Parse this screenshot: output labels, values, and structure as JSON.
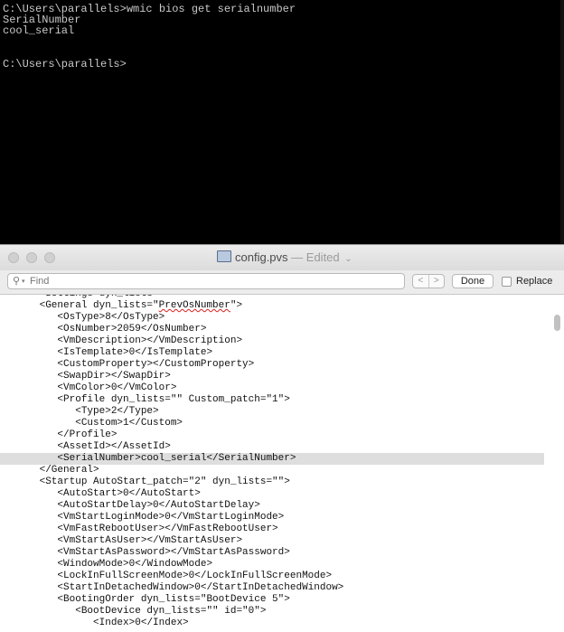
{
  "console": {
    "lines": [
      "C:\\Users\\parallels>wmic bios get serialnumber",
      "SerialNumber",
      "cool_serial",
      "",
      "",
      "C:\\Users\\parallels>"
    ]
  },
  "window": {
    "title": "config.pvs",
    "edited_label": "— Edited",
    "title_chevron": "⌄"
  },
  "findbar": {
    "search_placeholder": "Find",
    "prev_label": "<",
    "next_label": ">",
    "done_label": "Done",
    "replace_label": "Replace"
  },
  "editor": {
    "lines": [
      {
        "indent": 6,
        "text": "<Settings dyn_lists=\"\">"
      },
      {
        "indent": 6,
        "pre": "<General dyn_lists=\"",
        "spell": "PrevOsNumber",
        "post": "\">"
      },
      {
        "indent": 9,
        "text": "<OsType>8</OsType>"
      },
      {
        "indent": 9,
        "text": "<OsNumber>2059</OsNumber>"
      },
      {
        "indent": 9,
        "text": "<VmDescription></VmDescription>"
      },
      {
        "indent": 9,
        "text": "<IsTemplate>0</IsTemplate>"
      },
      {
        "indent": 9,
        "text": "<CustomProperty></CustomProperty>"
      },
      {
        "indent": 9,
        "text": "<SwapDir></SwapDir>"
      },
      {
        "indent": 9,
        "text": "<VmColor>0</VmColor>"
      },
      {
        "indent": 9,
        "text": "<Profile dyn_lists=\"\" Custom_patch=\"1\">"
      },
      {
        "indent": 12,
        "text": "<Type>2</Type>"
      },
      {
        "indent": 12,
        "text": "<Custom>1</Custom>"
      },
      {
        "indent": 9,
        "text": "</Profile>"
      },
      {
        "indent": 9,
        "text": "<AssetId></AssetId>"
      },
      {
        "indent": 9,
        "text": "<SerialNumber>cool_serial</SerialNumber>",
        "highlight": true
      },
      {
        "indent": 6,
        "text": "</General>"
      },
      {
        "indent": 6,
        "text": "<Startup AutoStart_patch=\"2\" dyn_lists=\"\">"
      },
      {
        "indent": 9,
        "text": "<AutoStart>0</AutoStart>"
      },
      {
        "indent": 9,
        "text": "<AutoStartDelay>0</AutoStartDelay>"
      },
      {
        "indent": 9,
        "text": "<VmStartLoginMode>0</VmStartLoginMode>"
      },
      {
        "indent": 9,
        "text": "<VmFastRebootUser></VmFastRebootUser>"
      },
      {
        "indent": 9,
        "text": "<VmStartAsUser></VmStartAsUser>"
      },
      {
        "indent": 9,
        "text": "<VmStartAsPassword></VmStartAsPassword>"
      },
      {
        "indent": 9,
        "text": "<WindowMode>0</WindowMode>"
      },
      {
        "indent": 9,
        "text": "<LockInFullScreenMode>0</LockInFullScreenMode>"
      },
      {
        "indent": 9,
        "text": "<StartInDetachedWindow>0</StartInDetachedWindow>"
      },
      {
        "indent": 9,
        "text": "<BootingOrder dyn_lists=\"BootDevice 5\">"
      },
      {
        "indent": 12,
        "text": "<BootDevice dyn_lists=\"\" id=\"0\">"
      },
      {
        "indent": 15,
        "text": "<Index>0</Index>"
      }
    ]
  }
}
